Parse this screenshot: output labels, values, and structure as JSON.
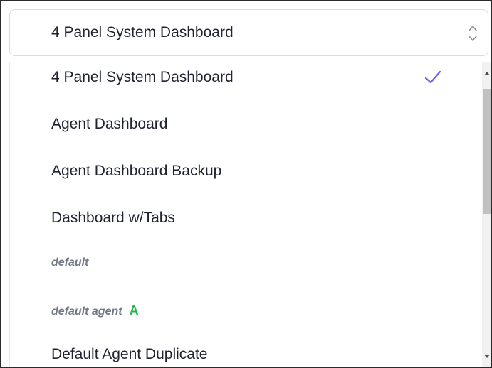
{
  "select": {
    "value": "4 Panel System Dashboard"
  },
  "dropdown": {
    "options": [
      {
        "label": "4 Panel System Dashboard",
        "selected": true
      },
      {
        "label": "Agent Dashboard"
      },
      {
        "label": "Agent Dashboard Backup"
      },
      {
        "label": "Dashboard w/Tabs"
      },
      {
        "label": "default"
      },
      {
        "label": "default agent",
        "badge": "A"
      },
      {
        "label": "Default Agent Duplicate"
      }
    ]
  },
  "colors": {
    "check": "#6b63e8",
    "badge": "#23b84c",
    "text": "#1f2330",
    "muted": "#737885"
  },
  "icons": {
    "select_arrows": "updown-chevron-icon",
    "selected_mark": "checkmark-icon"
  }
}
